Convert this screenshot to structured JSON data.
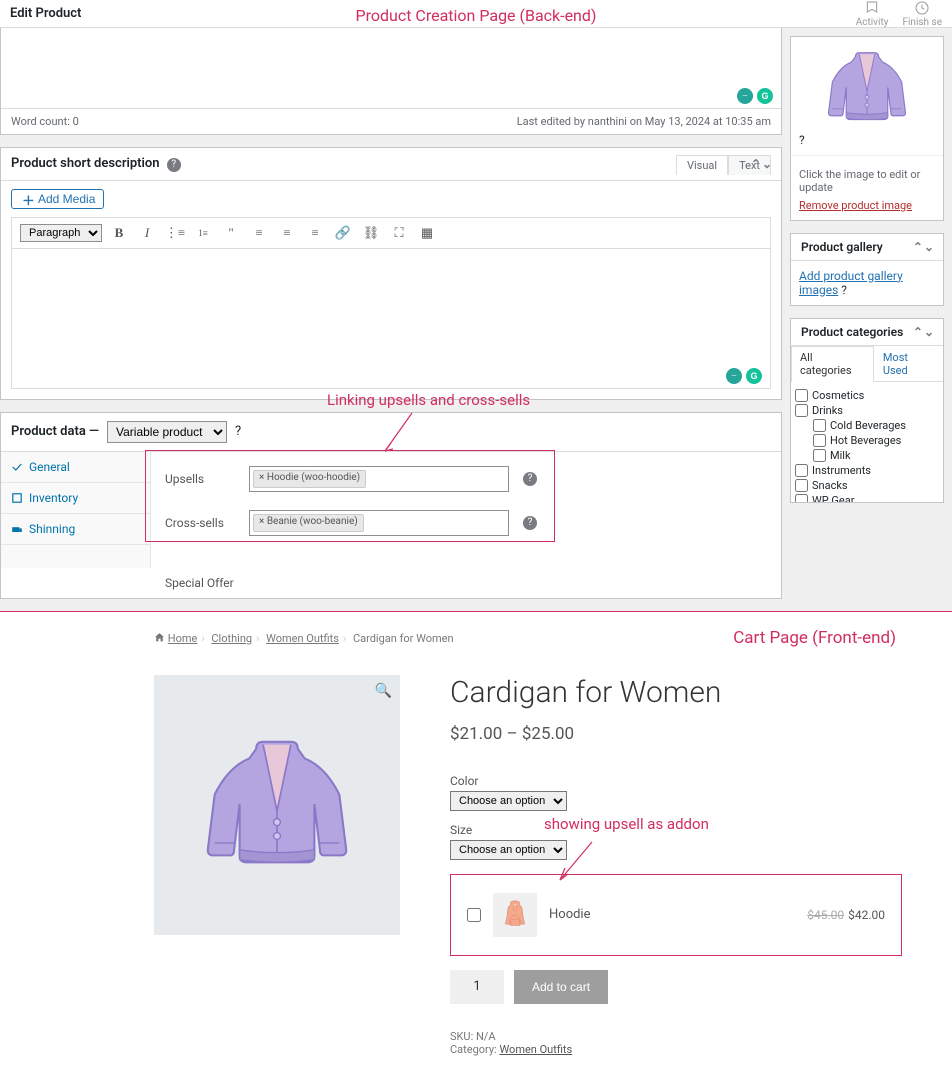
{
  "header": {
    "title": "Edit Product",
    "annot": "Product Creation Page (Back-end)",
    "activity": "Activity",
    "finish": "Finish se"
  },
  "editor": {
    "word_count": "Word count: 0",
    "last_edit": "Last edited by nanthini on May 13, 2024 at 10:35 am"
  },
  "short_desc": {
    "title": "Product short description"
  },
  "media_btn": "Add Media",
  "ed_tabs": {
    "visual": "Visual",
    "text": "Text"
  },
  "paragraph": "Paragraph",
  "pd": {
    "title": "Product data —",
    "type": "Variable product",
    "tabs": {
      "general": "General",
      "inventory": "Inventory",
      "shipping": "Shinning"
    },
    "upsells_lbl": "Upsells",
    "cross_lbl": "Cross-sells",
    "upsell_token": "× Hoodie (woo-hoodie)",
    "cross_token": "× Beanie (woo-beanie)",
    "special": "Special Offer"
  },
  "annotations": {
    "linking": "Linking upsells and cross-sells",
    "cart": "Cart Page (Front-end)",
    "addon": "showing upsell as addon"
  },
  "side": {
    "img_hint": "Click the image to edit or update",
    "remove": "Remove product image",
    "gallery_title": "Product gallery",
    "gallery_link": "Add product gallery images",
    "cat_title": "Product categories",
    "cat_all": "All categories",
    "cat_most": "Most Used",
    "cats": {
      "cosmetics": "Cosmetics",
      "drinks": "Drinks",
      "cold": "Cold Beverages",
      "hot": "Hot Beverages",
      "milk": "Milk",
      "instruments": "Instruments",
      "snacks": "Snacks",
      "wp": "WP Gear"
    }
  },
  "fe": {
    "bc": {
      "home": "Home",
      "clothing": "Clothing",
      "wo": "Women Outfits",
      "current": "Cardigan for Women"
    },
    "title": "Cardigan for Women",
    "price": "$21.00 – $25.00",
    "color_lbl": "Color",
    "size_lbl": "Size",
    "choose": "Choose an option",
    "addon_name": "Hoodie",
    "addon_old": "$45.00",
    "addon_new": "$42.00",
    "qty": "1",
    "addcart": "Add to cart",
    "sku": "SKU: N/A",
    "cat_lbl": "Category: ",
    "cat_val": "Women Outfits"
  }
}
